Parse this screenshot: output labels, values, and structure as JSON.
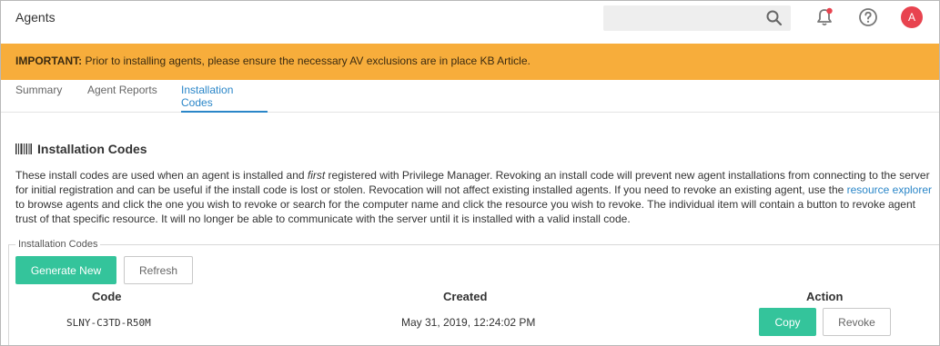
{
  "header": {
    "title": "Agents",
    "search": {
      "placeholder": ""
    },
    "icons": {
      "search": "search-icon",
      "notifications": "bell-icon",
      "help": "help-icon"
    },
    "avatar_initial": "A"
  },
  "banner": {
    "label": "IMPORTANT:",
    "message": "Prior to installing agents, please ensure the necessary AV exclusions are in place KB Article.",
    "color": "#f7ad3b"
  },
  "tabs": [
    {
      "label": "Summary"
    },
    {
      "label": "Agent Reports"
    },
    {
      "label": "Installation Codes",
      "active": true
    }
  ],
  "section": {
    "title": "Installation Codes",
    "description_part1": "These install codes are used when an agent is installed and ",
    "description_em": "first",
    "description_part2": " registered with Privilege Manager. Revoking an install code will prevent new agent installations from connecting to the server for initial registration and can be useful if the install code is lost or stolen. Revocation will not affect existing installed agents. If you need to revoke an existing agent, use the ",
    "description_link": "resource explorer",
    "description_part3": " to browse agents and click the one you wish to revoke or search for the computer name and click the resource you wish to revoke. The individual item will contain a button to revoke agent trust of that specific resource. It will no longer be able to communicate with the server until it is installed with a valid install code."
  },
  "panel": {
    "legend": "Installation Codes",
    "generate_label": "Generate New",
    "refresh_label": "Refresh",
    "columns": {
      "code": "Code",
      "created": "Created",
      "action": "Action"
    },
    "rows": [
      {
        "code": "SLNY-C3TD-R50M",
        "created": "May 31, 2019, 12:24:02 PM",
        "copy_label": "Copy",
        "revoke_label": "Revoke"
      }
    ]
  },
  "colors": {
    "accent": "#2a86c8",
    "primary_button": "#34c49b",
    "avatar": "#e8434f",
    "notification_dot": "#e8434f"
  }
}
